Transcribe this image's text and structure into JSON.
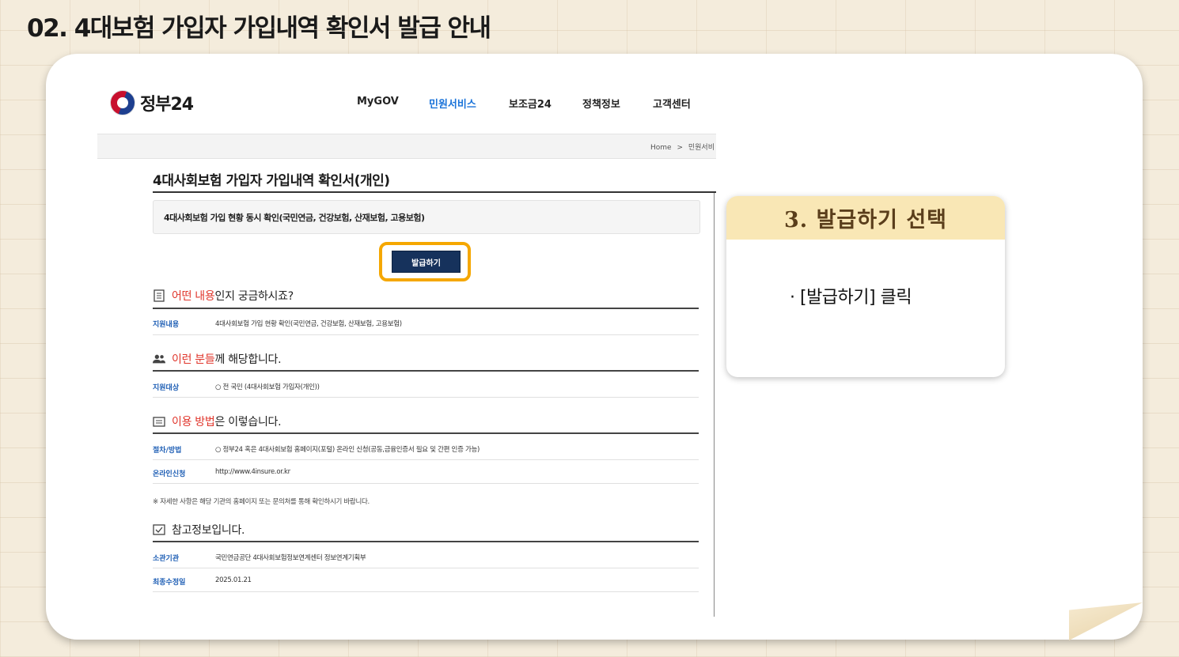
{
  "slide": {
    "title": "02. 4대보험 가입자 가입내역 확인서 발급 안내"
  },
  "header": {
    "logo_text": "정부24",
    "nav": [
      "MyGOV",
      "민원서비스",
      "보조금24",
      "정책정보",
      "고객센터"
    ],
    "active_nav": "민원서비스"
  },
  "breadcrumb": {
    "home": "Home",
    "separator": ">",
    "current": "민원서비"
  },
  "page": {
    "title": "4대사회보험 가입자 가입내역 확인서(개인)",
    "summary": "4대사회보험 가입 현황 동시 확인(국민연금, 건강보험, 산재보험, 고용보험)",
    "issue_button": "발급하기"
  },
  "sections": {
    "what": {
      "head_red": "어떤 내용",
      "head_rest": "인지 궁금하시죠?",
      "rows": [
        {
          "label": "지원내용",
          "value": "4대사회보험 가입 현황 확인(국민연금, 건강보험, 산재보험, 고용보험)"
        }
      ]
    },
    "who": {
      "head_red": "이런 분들",
      "head_rest": "께 해당합니다.",
      "rows": [
        {
          "label": "지원대상",
          "value": "○ 전 국민 (4대사회보험 가입자(개인))"
        }
      ]
    },
    "how": {
      "head_red": "이용 방법",
      "head_rest": "은 이렇습니다.",
      "rows": [
        {
          "label": "절차/방법",
          "value": "○ 정부24 혹은 4대사회보험 홈페이지(포털) 온라인 신청(공동,금융인증서 필요 및 간편 인증 가능)"
        },
        {
          "label": "온라인신청",
          "value": "http://www.4insure.or.kr"
        }
      ],
      "notice": "※ 자세한 사항은 해당 기관의 홈페이지 또는 문의처를 통해 확인하시기 바랍니다."
    },
    "ref": {
      "head": "참고정보입니다.",
      "rows": [
        {
          "label": "소관기관",
          "value": "국민연금공단 4대사회보험정보연계센터 정보연계기획부"
        },
        {
          "label": "최종수정일",
          "value": "2025.01.21"
        }
      ]
    }
  },
  "callout": {
    "title": "3. 발급하기 선택",
    "body": "· [발급하기] 클릭"
  },
  "colors": {
    "accent_blue": "#1a73d9",
    "highlight": "#f5a700",
    "button_navy": "#16325c",
    "red": "#e0352b",
    "callout_head": "#f9e7b5"
  }
}
